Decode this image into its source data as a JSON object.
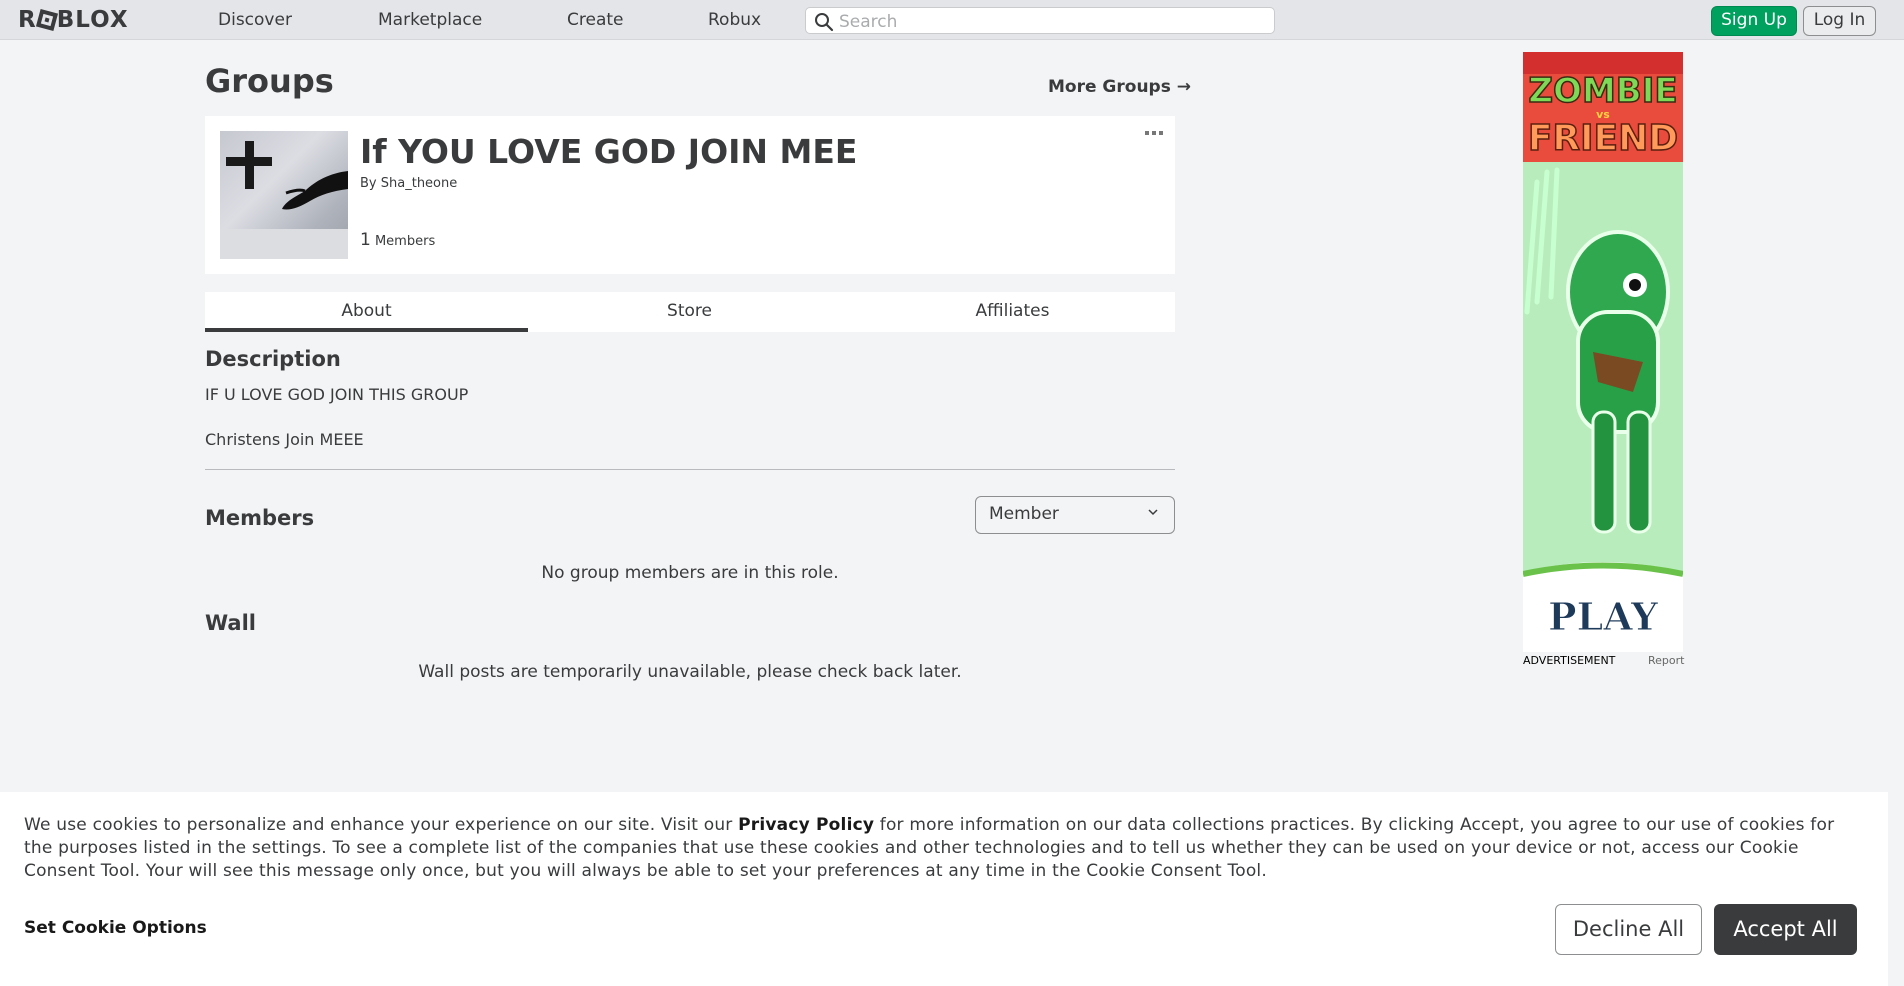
{
  "nav": {
    "logo": "ROBLOX",
    "links": [
      "Discover",
      "Marketplace",
      "Create",
      "Robux"
    ],
    "search_placeholder": "Search",
    "signup": "Sign Up",
    "login": "Log In"
  },
  "page": {
    "title": "Groups",
    "more_groups": "More Groups →"
  },
  "group": {
    "name": "If YOU LOVE GOD JOIN MEE",
    "by_prefix": "By",
    "owner": "Sha_theone",
    "member_count": "1",
    "member_label": "Members",
    "menu_icon": "ellipsis-icon"
  },
  "tabs": [
    "About",
    "Store",
    "Affiliates"
  ],
  "about": {
    "description_heading": "Description",
    "description_lines": [
      "IF U LOVE GOD JOIN THIS GROUP",
      "Christens Join MEEE"
    ]
  },
  "members": {
    "heading": "Members",
    "role_selected": "Member",
    "empty_message": "No group members are in this role."
  },
  "wall": {
    "heading": "Wall",
    "message": "Wall posts are temporarily unavailable, please check back later."
  },
  "ad": {
    "title_top": "ZOMBIE",
    "title_vs": "vs",
    "title_bottom": "FRIEND",
    "cta": "PLAY",
    "label": "ADVERTISEMENT",
    "report": "Report"
  },
  "cookie": {
    "text_before": "We use cookies to personalize and enhance your experience on our site. Visit our ",
    "link": "Privacy Policy",
    "text_after": " for more information on our data collections practices. By clicking Accept, you agree to our use of cookies for the purposes listed in the settings. To see a complete list of the companies that use these cookies and other technologies and to tell us whether they can be used on your device or not, access our Cookie Consent Tool. Your will see this message only once, but you will always be able to set your preferences at any time in the Cookie Consent Tool.",
    "options": "Set Cookie Options",
    "decline": "Decline All",
    "accept": "Accept All"
  },
  "colors": {
    "signup_green": "#00a05e",
    "text_dark": "#393b3d",
    "accept_bg": "#393b3d"
  }
}
